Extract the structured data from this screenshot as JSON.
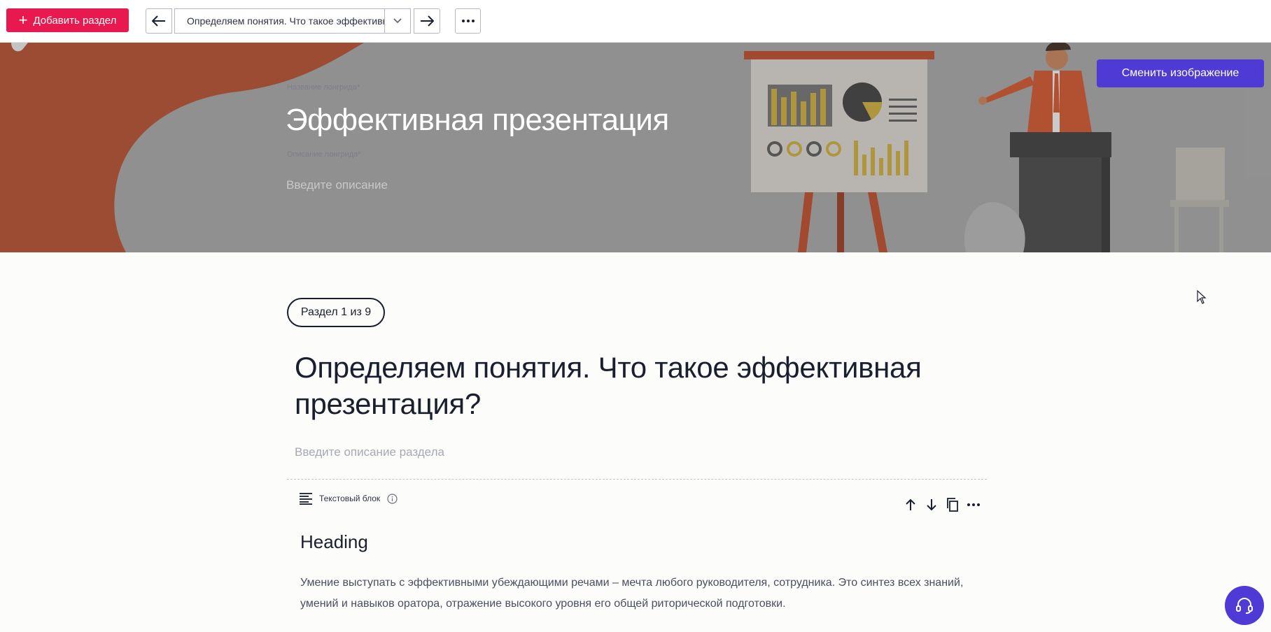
{
  "toolbar": {
    "add_section_label": "Добавить раздел",
    "current_section": "Определяем понятия. Что такое эффективная презентация?",
    "icons": [
      "plus-icon",
      "arrow-left-icon",
      "chevron-down-icon",
      "arrow-right-icon",
      "more-horizontal-icon"
    ]
  },
  "banner": {
    "title_label": "Название лонгрида*",
    "title": "Эффективная презентация",
    "desc_label": "Описание лонгрида*",
    "desc_placeholder": "Введите описание",
    "change_image_label": "Сменить изображение"
  },
  "section": {
    "counter": "Раздел 1 из 9",
    "title": "Определяем понятия. Что такое эффективная презентация?",
    "desc_placeholder": "Введите описание раздела"
  },
  "block": {
    "type_label": "Текстовый блок",
    "heading": "Heading",
    "text": "Умение выступать с эффективными убеждающими речами – мечта любого руководителя, сотрудника. Это синтез всех знаний, умений и навыков оратора, отражение высокого уровня его общей риторической подготовки.",
    "icons": [
      "text-block-icon",
      "info-icon",
      "arrow-up-icon",
      "arrow-down-icon",
      "copy-icon",
      "more-horizontal-icon"
    ]
  },
  "colors": {
    "accent_red": "#e8194f",
    "accent_purple": "#4f3ad6",
    "banner_orange": "#a84a2c"
  }
}
